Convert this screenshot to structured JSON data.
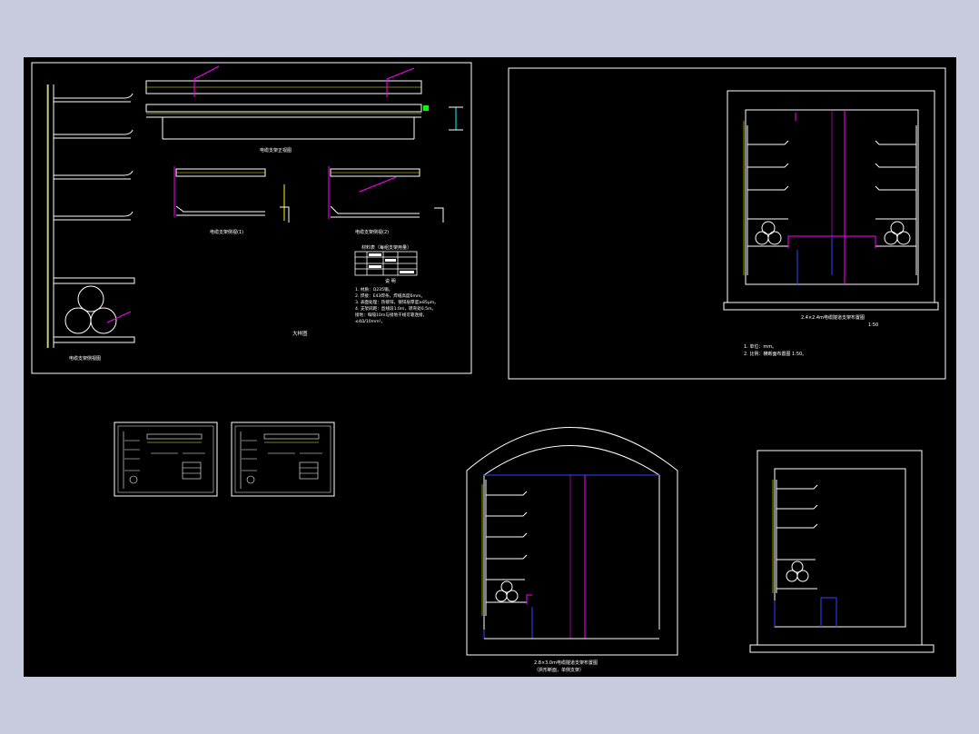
{
  "colors": {
    "background": "#c8cade",
    "canvas": "#000000",
    "line": "#ffffff",
    "magenta": "#ff00ff",
    "blue": "#3344ff",
    "cyan": "#00ffff",
    "yellow": "#ffff00",
    "green": "#00ff00"
  },
  "sheet1": {
    "elevation_label": "电缆支架侧视图",
    "rail_label": "电缆支架正视图",
    "detail1_label": "电缆支架侧视(1)",
    "detail2_label": "电缆支架侧视(2)",
    "table_title": "材料表（每组支架用量）",
    "table_sub": "说    明",
    "notes": [
      "1. 材质：Q235钢。",
      "2. 焊接：E43焊条，焊缝高度6mm。",
      "3. 表面处理：热镀锌，镀锌层厚度≥85μm。",
      "4. 支架间距：直线段1.0m，转弯处0.5m。",
      "   接地：每隔10m与接地干线可靠连接，",
      "   ≤4Ω/10mm²。"
    ],
    "big_label": "大样图"
  },
  "sheet2": {
    "section_title": "2.4×2.4m电缆隧道支架布置图",
    "scale": "1:50",
    "notes": [
      "1. 单位：mm。",
      "2. 比例：横断面布置图 1:50。"
    ]
  },
  "arch": {
    "title_line1": "2.8×3.0m电缆隧道支架布置图",
    "title_line2": "（拱形断面，单侧支架）"
  }
}
